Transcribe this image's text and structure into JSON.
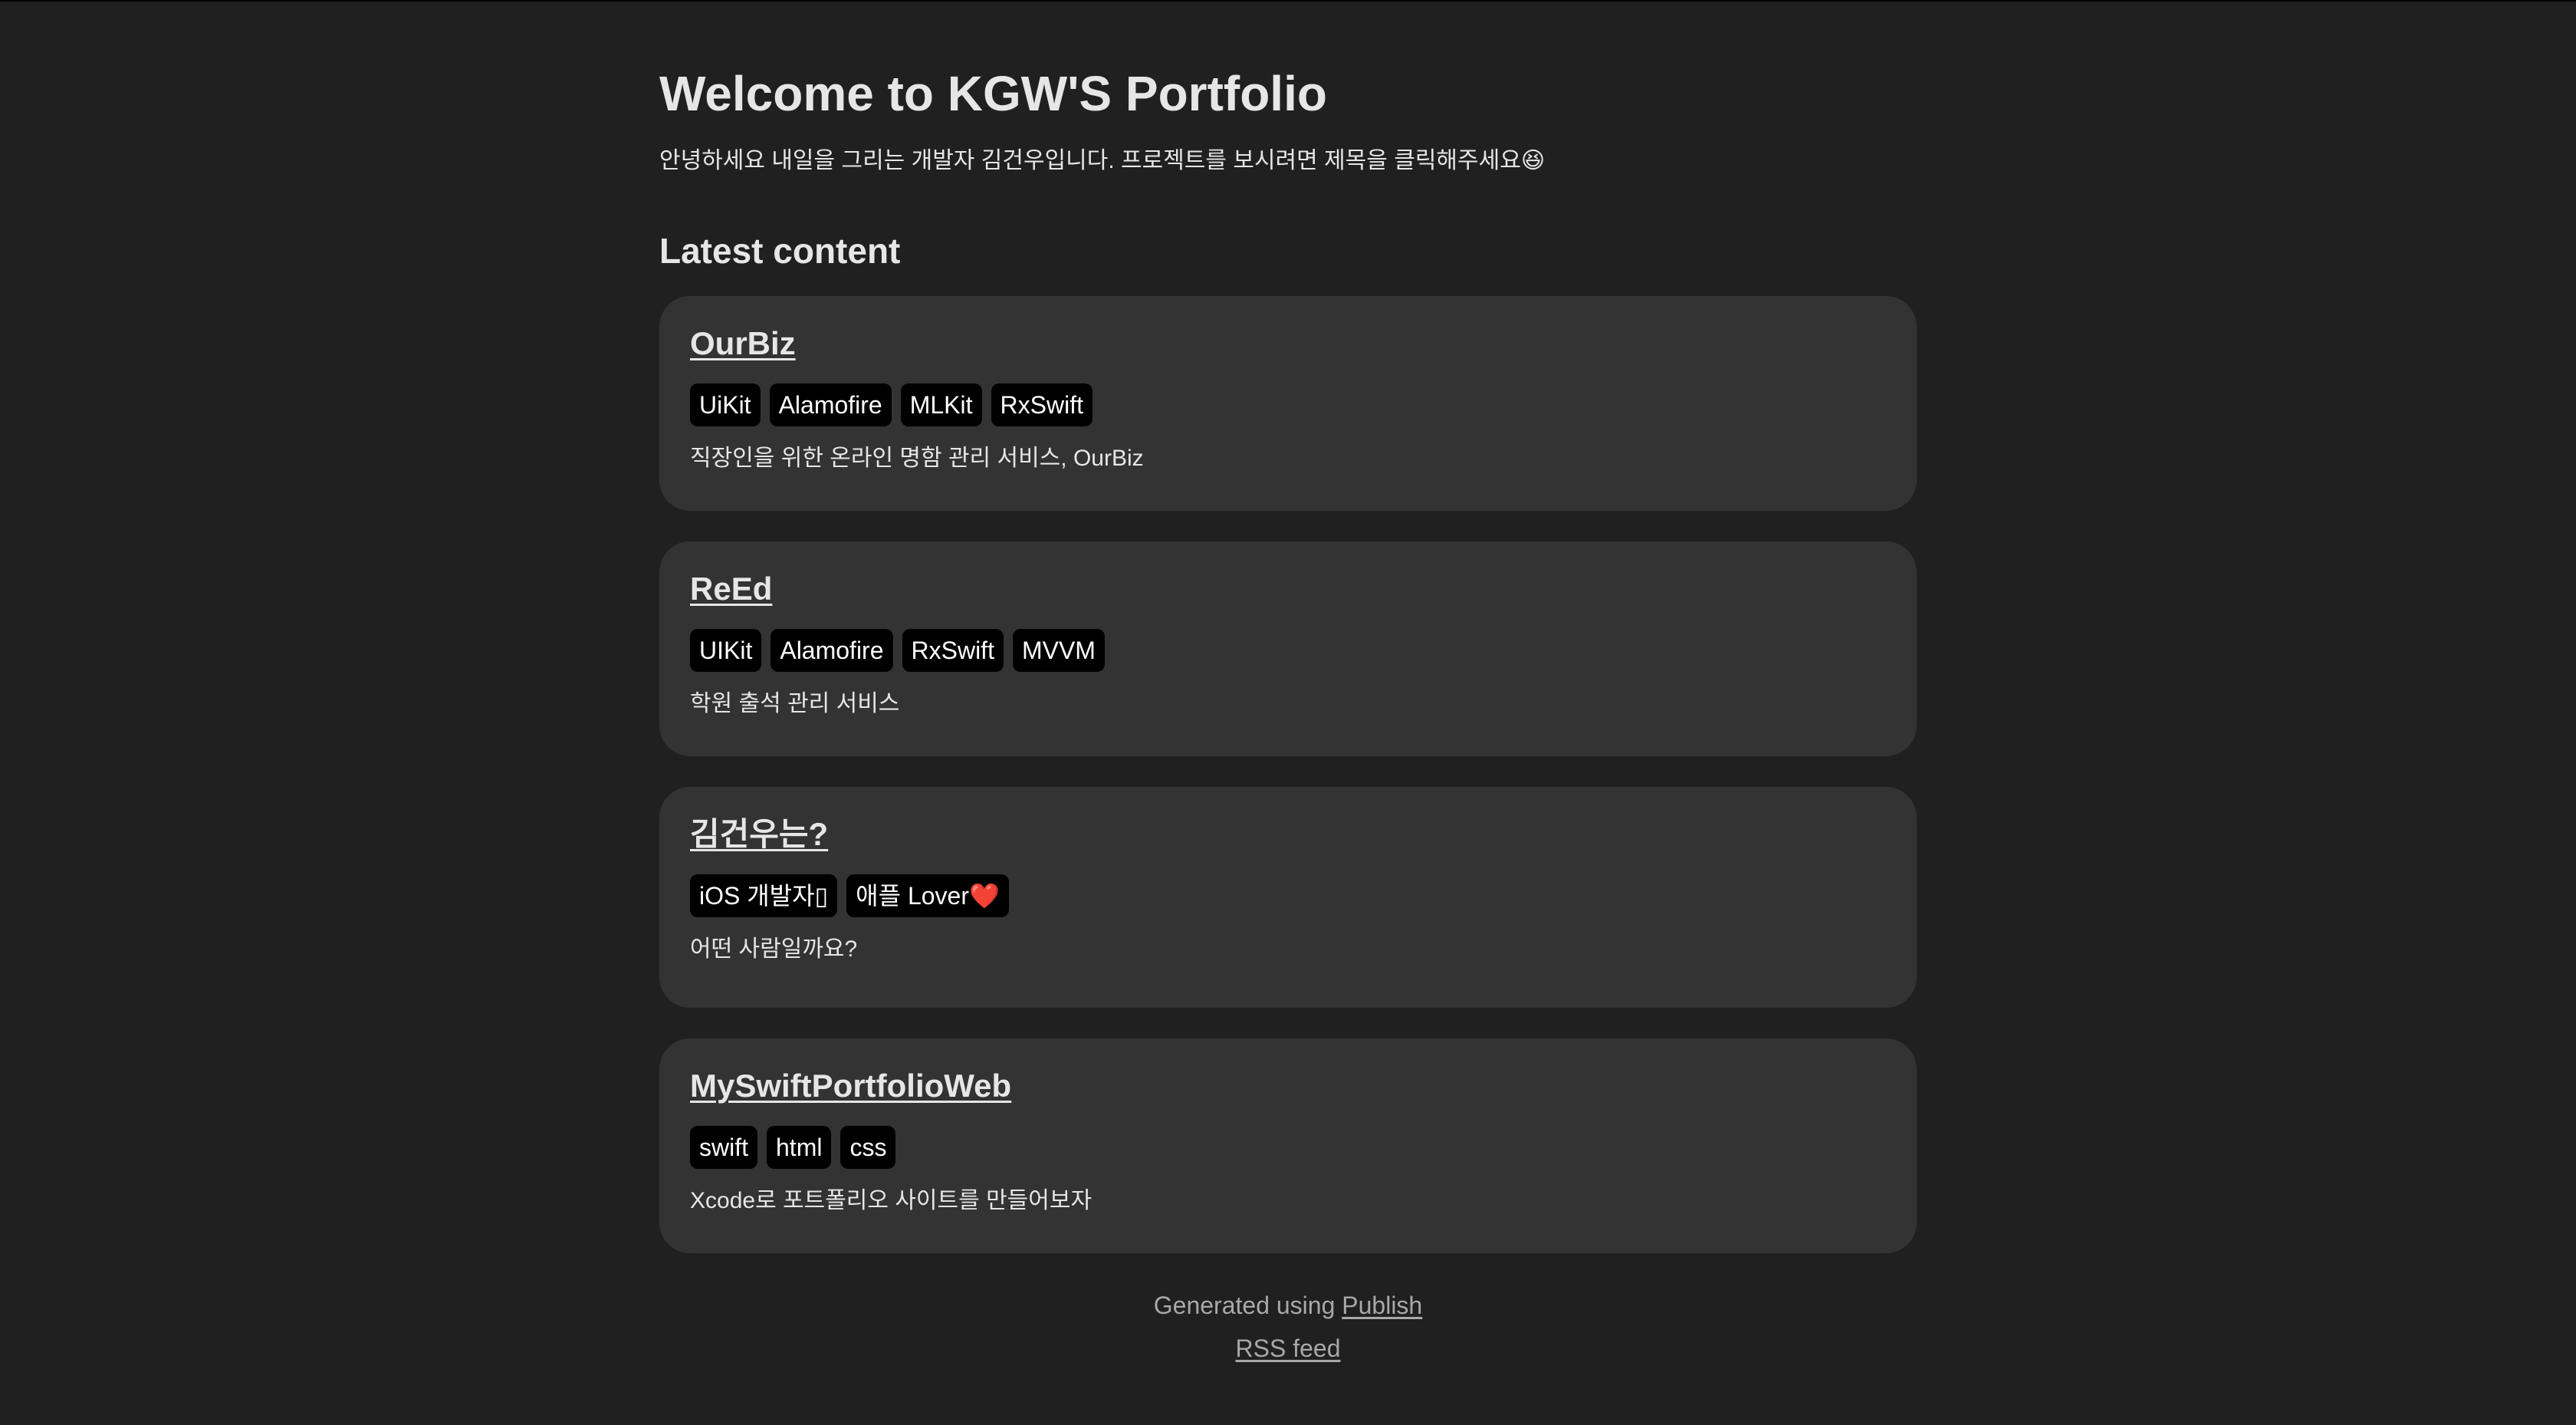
{
  "header": {
    "title": "Welcome to KGW'S Portfolio",
    "description": "안녕하세요 내일을 그리는 개발자 김건우입니다. 프로젝트를 보시려면 제목을 클릭해주세요😆"
  },
  "main": {
    "section_heading": "Latest content",
    "items": [
      {
        "title": "OurBiz",
        "tags": [
          "UiKit",
          "Alamofire",
          "MLKit",
          "RxSwift"
        ],
        "description": "직장인을 위한 온라인 명함 관리 서비스, OurBiz"
      },
      {
        "title": "ReEd",
        "tags": [
          "UIKit",
          "Alamofire",
          "RxSwift",
          "MVVM"
        ],
        "description": "학원 출석 관리 서비스"
      },
      {
        "title": "김건우는?",
        "tags": [
          "iOS 개발자▯",
          "애플 Lover❤️"
        ],
        "description": "어떤 사람일까요?"
      },
      {
        "title": "MySwiftPortfolioWeb",
        "tags": [
          "swift",
          "html",
          "css"
        ],
        "description": "Xcode로 포트폴리오 사이트를 만들어보자"
      }
    ]
  },
  "footer": {
    "generated_prefix": "Generated using ",
    "publish_link": "Publish",
    "rss_link": "RSS feed"
  },
  "colors": {
    "background": "#202020",
    "card": "#333333",
    "text": "#e6e6e6",
    "tag_background": "#000000",
    "footer_text": "#a8a8a8"
  }
}
